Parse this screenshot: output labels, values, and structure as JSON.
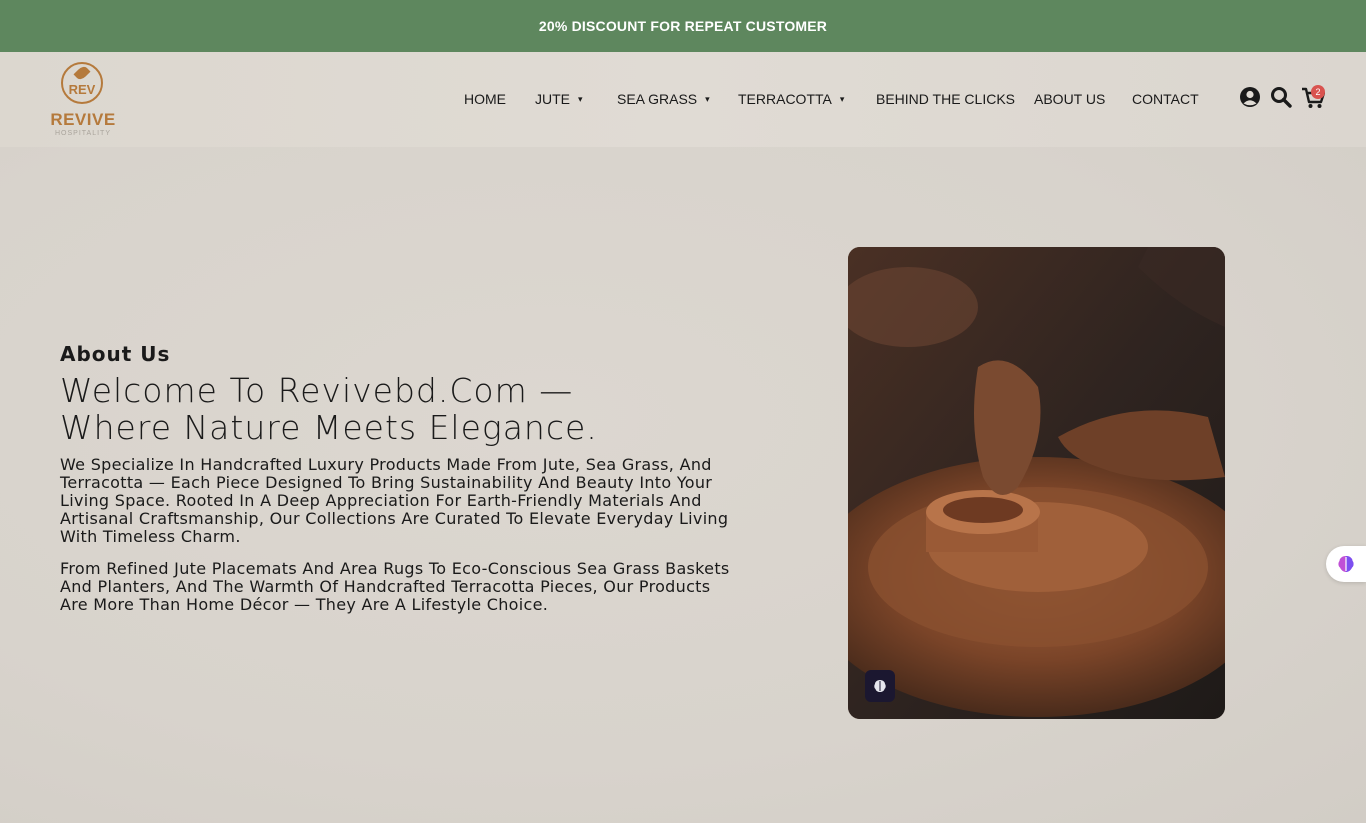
{
  "announcement": "20% DISCOUNT FOR REPEAT CUSTOMER",
  "brand": {
    "mark": "REV",
    "name": "REVIVE",
    "tagline": "HOSPITALITY"
  },
  "nav": {
    "items": [
      {
        "label": "HOME",
        "dropdown": false
      },
      {
        "label": "JUTE",
        "dropdown": true
      },
      {
        "label": "SEA GRASS",
        "dropdown": true
      },
      {
        "label": "TERRACOTTA",
        "dropdown": true
      },
      {
        "label": "BEHIND THE CLICKS",
        "dropdown": false
      },
      {
        "label": "ABOUT US",
        "dropdown": false
      },
      {
        "label": "CONTACT",
        "dropdown": false
      }
    ],
    "caret": "▾"
  },
  "header_icons": {
    "account": "user-circle-icon",
    "search": "search-icon",
    "cart": "cart-icon",
    "cart_count": "2"
  },
  "hero": {
    "eyebrow": "About Us",
    "headline_line1": "Welcome To Revivebd.Com —",
    "headline_line2": "Where Nature Meets Elegance.",
    "paragraph1": "We Specialize In Handcrafted Luxury Products Made From Jute, Sea Grass, And Terracotta — Each Piece Designed To Bring Sustainability And Beauty Into Your Living Space. Rooted In A Deep Appreciation For Earth-Friendly Materials And Artisanal Craftsmanship, Our Collections Are Curated To Elevate Everyday Living With Timeless Charm.",
    "paragraph2": "From Refined Jute Placemats And Area Rugs To Eco-Conscious Sea Grass Baskets And Planters, And The Warmth Of Handcrafted Terracotta Pieces, Our Products Are More Than Home Décor — They Are A Lifestyle Choice."
  },
  "colors": {
    "topbar": "#5e875e",
    "brand": "#b57a3c",
    "badge": "#d9534f",
    "text": "#1a1a1a"
  }
}
